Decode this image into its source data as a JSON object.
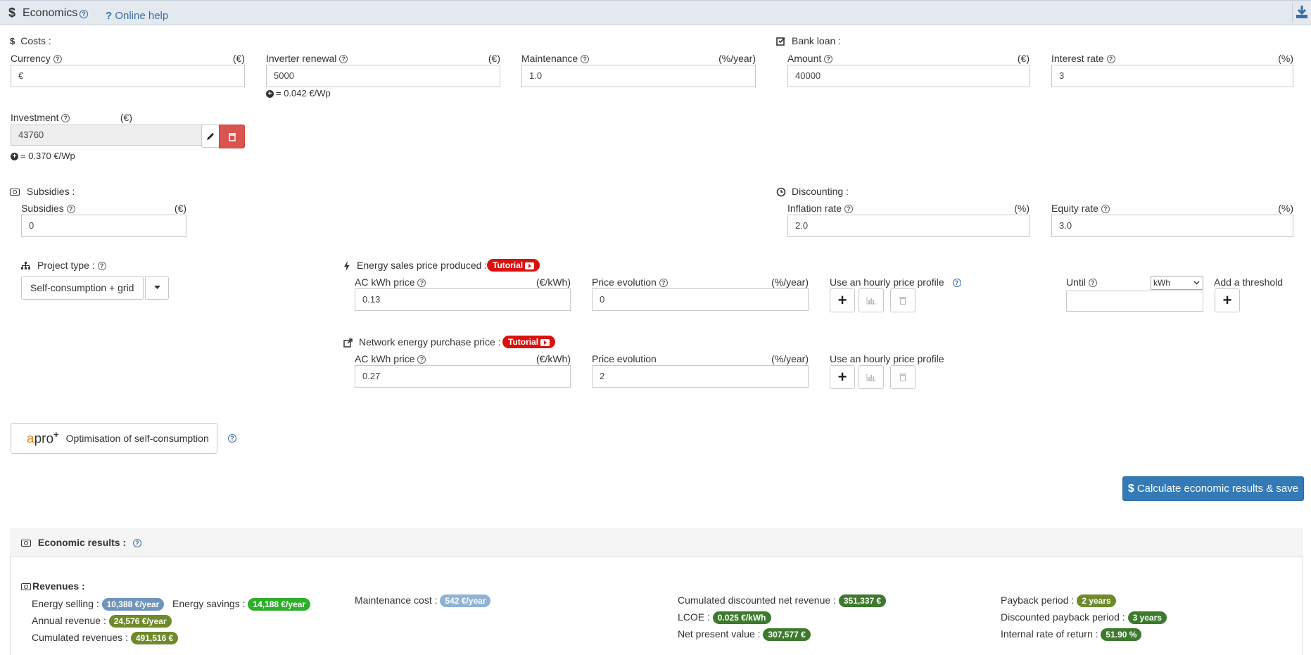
{
  "header": {
    "title": "Economics",
    "online_help": "Online help"
  },
  "costs": {
    "title": "Costs :",
    "currency": {
      "label": "Currency",
      "unit": "(€)",
      "value": "€"
    },
    "inverter": {
      "label": "Inverter renewal",
      "unit": "(€)",
      "value": "5000",
      "note": "= 0.042 €/Wp"
    },
    "maintenance": {
      "label": "Maintenance",
      "unit": "(%/year)",
      "value": "1.0"
    },
    "investment": {
      "label": "Investment",
      "unit": "(€)",
      "value": "43760",
      "note": "= 0.370 €/Wp"
    }
  },
  "loan": {
    "title": "Bank loan :",
    "amount": {
      "label": "Amount",
      "unit": "(€)",
      "value": "40000"
    },
    "interest": {
      "label": "Interest rate",
      "unit": "(%)",
      "value": "3"
    }
  },
  "subsidies": {
    "title": "Subsidies :",
    "field": {
      "label": "Subsidies",
      "unit": "(€)",
      "value": "0"
    }
  },
  "discounting": {
    "title": "Discounting :",
    "inflation": {
      "label": "Inflation rate",
      "unit": "(%)",
      "value": "2.0"
    },
    "equity": {
      "label": "Equity rate",
      "unit": "(%)",
      "value": "3.0"
    }
  },
  "project": {
    "title": "Project type :",
    "value": "Self-consumption + grid"
  },
  "sales": {
    "title": "Energy sales price produced :",
    "tutorial": "Tutorial",
    "price": {
      "label": "AC kWh price",
      "unit": "(€/kWh)",
      "value": "0.13"
    },
    "evolution": {
      "label": "Price evolution",
      "unit": "(%/year)",
      "value": "0"
    },
    "hourly": "Use an hourly price profile",
    "until": {
      "label": "Until",
      "select": "kWh",
      "value": ""
    },
    "threshold": "Add a threshold"
  },
  "purchase": {
    "title": "Network energy purchase price :",
    "tutorial": "Tutorial",
    "price": {
      "label": "AC kWh price",
      "unit": "(€/kWh)",
      "value": "0.27"
    },
    "evolution": {
      "label": "Price evolution",
      "unit": "(%/year)",
      "value": "2"
    },
    "hourly": "Use an hourly price profile"
  },
  "apro": {
    "logo_a": "a",
    "logo_pro": "pro",
    "logo_plus": "+",
    "label": "Optimisation of self-consumption"
  },
  "calculate_label": "Calculate economic results & save",
  "results": {
    "title": "Economic results :",
    "revenues_title": "Revenues :",
    "energy_selling": {
      "label": "Energy selling :",
      "value": "10,388 €/year"
    },
    "energy_savings": {
      "label": "Energy savings :",
      "value": "14,188 €/year"
    },
    "annual_revenue": {
      "label": "Annual revenue :",
      "value": "24,576 €/year"
    },
    "cumulated_revenues": {
      "label": "Cumulated revenues :",
      "value": "491,516 €"
    },
    "maintenance_cost": {
      "label": "Maintenance cost :",
      "value": "542 €/year"
    },
    "cum_disc_net": {
      "label": "Cumulated discounted net revenue :",
      "value": "351,337 €"
    },
    "lcoe": {
      "label": "LCOE :",
      "value": "0.025 €/kWh"
    },
    "npv": {
      "label": "Net present value :",
      "value": "307,577 €"
    },
    "payback": {
      "label": "Payback period :",
      "value": "2 years"
    },
    "disc_payback": {
      "label": "Discounted payback period :",
      "value": "3 years"
    },
    "irr": {
      "label": "Internal rate of return :",
      "value": "51.90 %"
    }
  },
  "colors": {
    "badge_blue": "#6f95b8",
    "badge_green": "#2fae2c",
    "badge_olive": "#6f8a2a",
    "badge_dark": "#3c7a2c",
    "badge_light": "#8fb3d3",
    "tutorial_red": "#d9120f",
    "calc_blue": "#337ab7"
  }
}
